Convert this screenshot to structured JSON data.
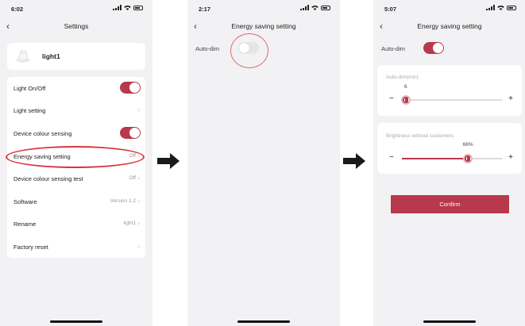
{
  "screen1": {
    "time": "6:02",
    "title": "Settings",
    "device_name": "light1",
    "rows": [
      {
        "label": "Light On/Off",
        "value": "",
        "control": "toggle-on"
      },
      {
        "label": "Light setting",
        "value": "",
        "control": "chevron"
      },
      {
        "label": "Device colour sensing",
        "value": "",
        "control": "toggle-on"
      },
      {
        "label": "Energy saving setting",
        "value": "Off",
        "control": "chevron"
      },
      {
        "label": "Device colour sensing test",
        "value": "Off",
        "control": "chevron"
      },
      {
        "label": "Software",
        "value": "Version 1.2",
        "control": "chevron"
      },
      {
        "label": "Rename",
        "value": "light1",
        "control": "chevron"
      },
      {
        "label": "Factory reset",
        "value": "",
        "control": "chevron"
      }
    ]
  },
  "screen2": {
    "time": "2:17",
    "title": "Energy saving setting",
    "auto_dim_label": "Auto-dim",
    "auto_dim_on": false
  },
  "screen3": {
    "time": "5:07",
    "title": "Energy saving setting",
    "auto_dim_label": "Auto-dim",
    "auto_dim_on": true,
    "auto_dim_min": {
      "label": "Auto-dim(min)",
      "value": "6",
      "level": 0.04
    },
    "brightness": {
      "label": "Brightness without customers",
      "value": "66%",
      "level": 0.66
    },
    "confirm_label": "Confirm",
    "minus": "−",
    "plus": "+"
  },
  "icons": {
    "back": "chevron-left-icon",
    "chevron": "chevron-right-icon",
    "arrow": "right-arrow-icon",
    "device": "light-bulb-icon"
  },
  "colors": {
    "accent": "#b8384c",
    "highlight": "#d9363e",
    "background": "#f2f2f4"
  }
}
